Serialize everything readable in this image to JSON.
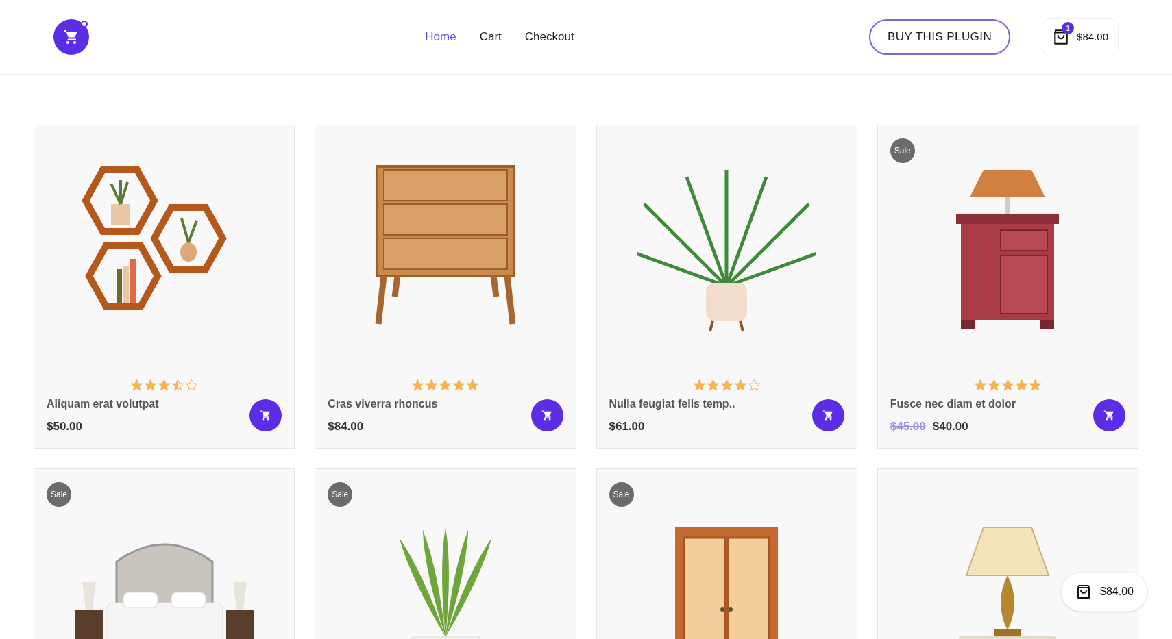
{
  "header": {
    "nav": [
      {
        "label": "Home",
        "selected": true
      },
      {
        "label": "Cart",
        "selected": false
      },
      {
        "label": "Checkout",
        "selected": false
      }
    ],
    "buy_button": "BUY THIS PLUGIN",
    "cart": {
      "count": "1",
      "total": "$84.00"
    }
  },
  "products": [
    {
      "kind": "hex-shelves",
      "sale": false,
      "stars": 3.5,
      "name": "Aliquam erat volutpat",
      "price": "$50.00"
    },
    {
      "kind": "dresser",
      "sale": false,
      "stars": 5,
      "name": "Cras viverra rhoncus",
      "price": "$84.00"
    },
    {
      "kind": "palm",
      "sale": false,
      "stars": 4,
      "name": "Nulla feugiat felis temp..",
      "price": "$61.00"
    },
    {
      "kind": "nightstand",
      "sale": true,
      "badge": "Sale",
      "stars": 5,
      "name": "Fusce nec diam et dolor",
      "old_price": "$45.00",
      "price": "$40.00"
    },
    {
      "kind": "bed",
      "sale": true,
      "badge": "Sale"
    },
    {
      "kind": "aloe",
      "sale": true,
      "badge": "Sale"
    },
    {
      "kind": "wardrobe",
      "sale": true,
      "badge": "Sale"
    },
    {
      "kind": "lamp",
      "sale": false
    }
  ],
  "floating_cart": {
    "total": "$84.00"
  }
}
